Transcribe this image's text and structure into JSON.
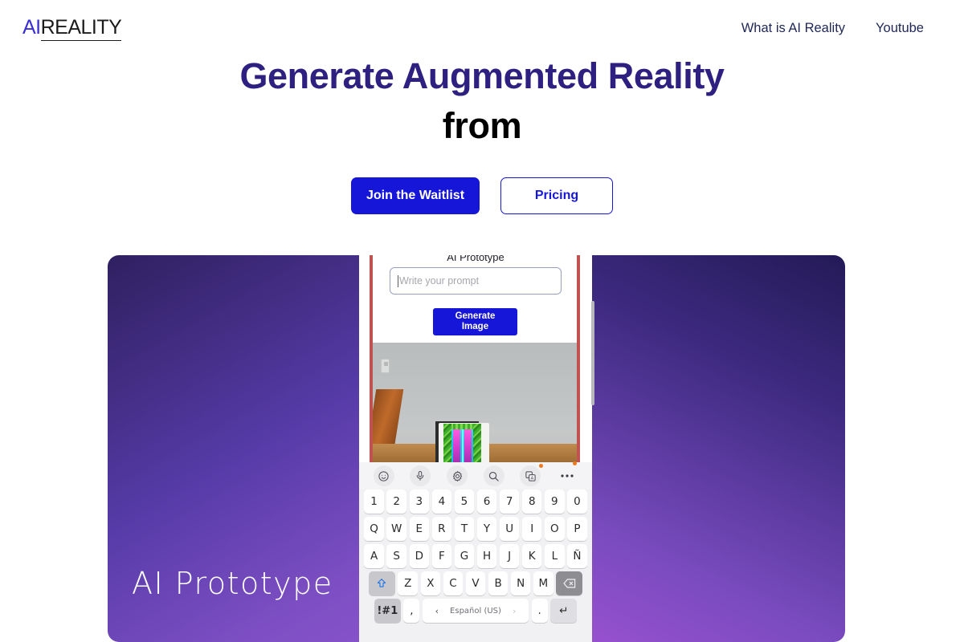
{
  "header": {
    "logo": {
      "part1": "AI",
      "part2": "REALITY"
    },
    "nav": [
      {
        "label": "What is AI Reality"
      },
      {
        "label": "Youtube"
      }
    ]
  },
  "hero": {
    "line1": "Generate Augmented Reality",
    "line2": "from",
    "primary_cta": "Join the Waitlist",
    "secondary_cta": "Pricing"
  },
  "showcase": {
    "caption": "AI Prototype",
    "phone": {
      "app_title": "AI Prototype",
      "prompt_placeholder": "Write your prompt",
      "prompt_value": "",
      "generate_button": "Generate\nImage"
    },
    "keyboard": {
      "toolbar": [
        {
          "name": "emoji-icon"
        },
        {
          "name": "microphone-icon"
        },
        {
          "name": "settings-gear-icon"
        },
        {
          "name": "search-icon"
        },
        {
          "name": "translate-icon",
          "badge": true
        },
        {
          "name": "more-options-icon",
          "badge": true
        }
      ],
      "row_numbers": [
        "1",
        "2",
        "3",
        "4",
        "5",
        "6",
        "7",
        "8",
        "9",
        "0"
      ],
      "row_top": [
        "Q",
        "W",
        "E",
        "R",
        "T",
        "Y",
        "U",
        "I",
        "O",
        "P"
      ],
      "row_home": [
        "A",
        "S",
        "D",
        "F",
        "G",
        "H",
        "J",
        "K",
        "L",
        "Ñ"
      ],
      "row_bottom": [
        "Z",
        "X",
        "C",
        "V",
        "B",
        "N",
        "M"
      ],
      "shift_key": "shift",
      "backspace_key": "backspace",
      "symbols_key": "!#1",
      "comma_key": ",",
      "period_key": ".",
      "enter_key": "↵",
      "space_label": "Español (US)",
      "space_prev": "‹",
      "space_next": "›"
    }
  },
  "colors": {
    "brand_blue": "#1616d8",
    "heading_purple": "#2e2080",
    "nav_navy": "#1f2757",
    "badge_orange": "#f2771a"
  }
}
